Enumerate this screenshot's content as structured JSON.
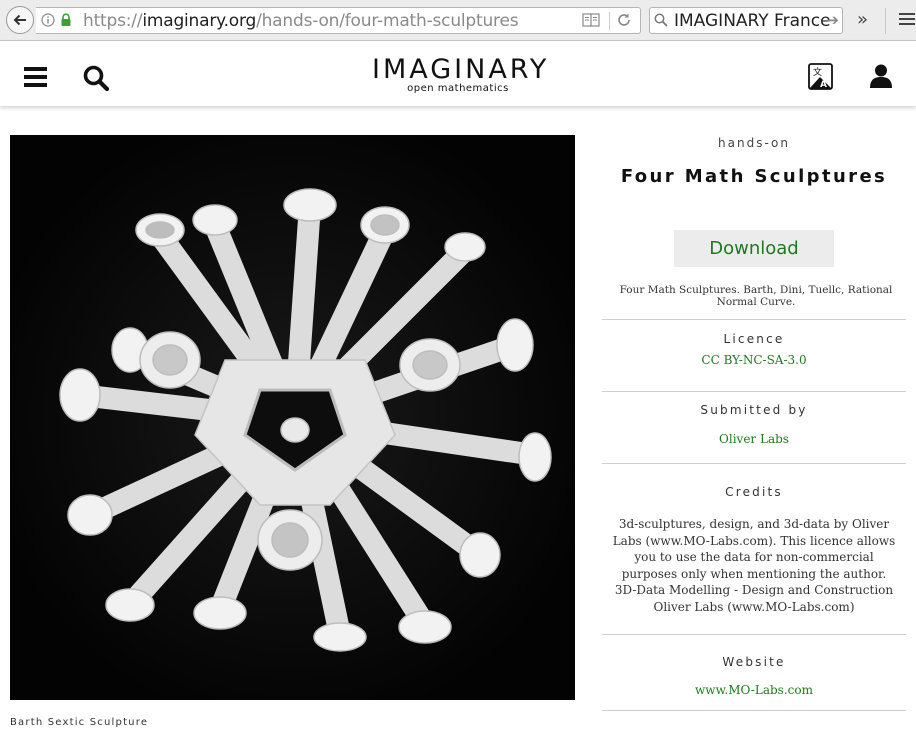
{
  "browser": {
    "url_scheme": "https://",
    "url_host": "imaginary.org",
    "url_path": "/hands-on/four-math-sculptures",
    "search_value": "IMAGINARY France",
    "icons": [
      "back-arrow-icon",
      "info-icon",
      "lock-icon",
      "reader-view-icon",
      "reload-icon",
      "search-icon",
      "overflow-icon",
      "menu-icon"
    ]
  },
  "header": {
    "logo_title": "IMAGINARY",
    "logo_subtitle": "open mathematics",
    "icons": [
      "hamburger-icon",
      "search-icon",
      "language-icon",
      "user-icon"
    ]
  },
  "main": {
    "image_caption": "Barth Sextic Sculpture"
  },
  "sidebar": {
    "kind": "hands-on",
    "title": "Four Math Sculptures",
    "download_label": "Download",
    "description": "Four Math Sculptures. Barth, Dini, Tuellc, Rational Normal Curve.",
    "licence_heading": "Licence",
    "licence_value": "CC BY-NC-SA-3.0",
    "submitted_heading": "Submitted by",
    "submitted_value": "Oliver Labs",
    "credits_heading": "Credits",
    "credits_lines": [
      "3d-sculptures, design, and 3d-data by Oliver Labs (www.MO-Labs.com). This licence allows you to use the data for non-commercial purposes only when mentioning the author.",
      "3D-Data Modelling - Design and Construction",
      "Oliver Labs (www.MO-Labs.com)"
    ],
    "website_heading": "Website",
    "website_value": "www.MO-Labs.com"
  },
  "colors": {
    "link_green": "#1f7a1f",
    "image_background": "#050505",
    "download_bg": "#ececec"
  }
}
